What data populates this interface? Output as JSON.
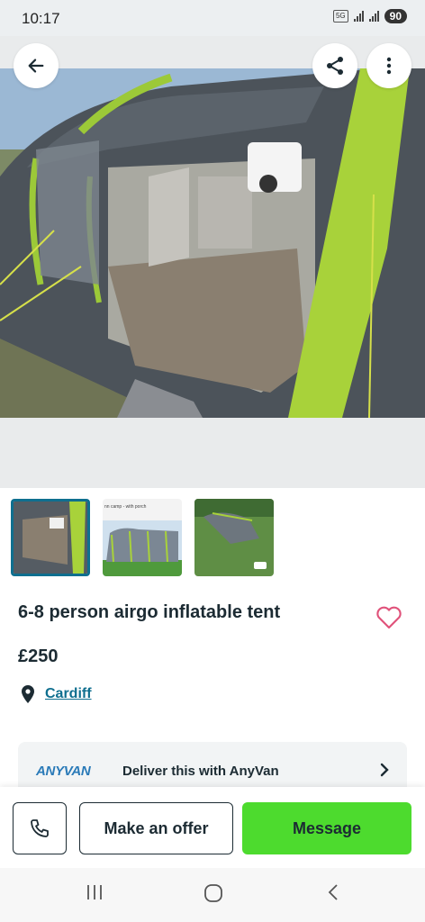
{
  "status_bar": {
    "time": "10:17",
    "network": "5G",
    "battery": "90"
  },
  "top_actions": {
    "back": "back-arrow-icon",
    "share": "share-icon",
    "more": "more-vertical-icon"
  },
  "thumbnails": [
    {
      "caption": ""
    },
    {
      "caption": "nn camp - with porch"
    },
    {
      "caption": ""
    }
  ],
  "listing": {
    "title": "6-8 person airgo inflatable tent",
    "price": "£250",
    "location": "Cardiff"
  },
  "delivery": {
    "logo": "ANYVAN",
    "text": "Deliver this with AnyVan"
  },
  "actions": {
    "offer": "Make an offer",
    "message": "Message"
  },
  "colors": {
    "accent": "#0f6f8f",
    "message_button": "#4ddb2e",
    "text": "#1c2b33"
  }
}
